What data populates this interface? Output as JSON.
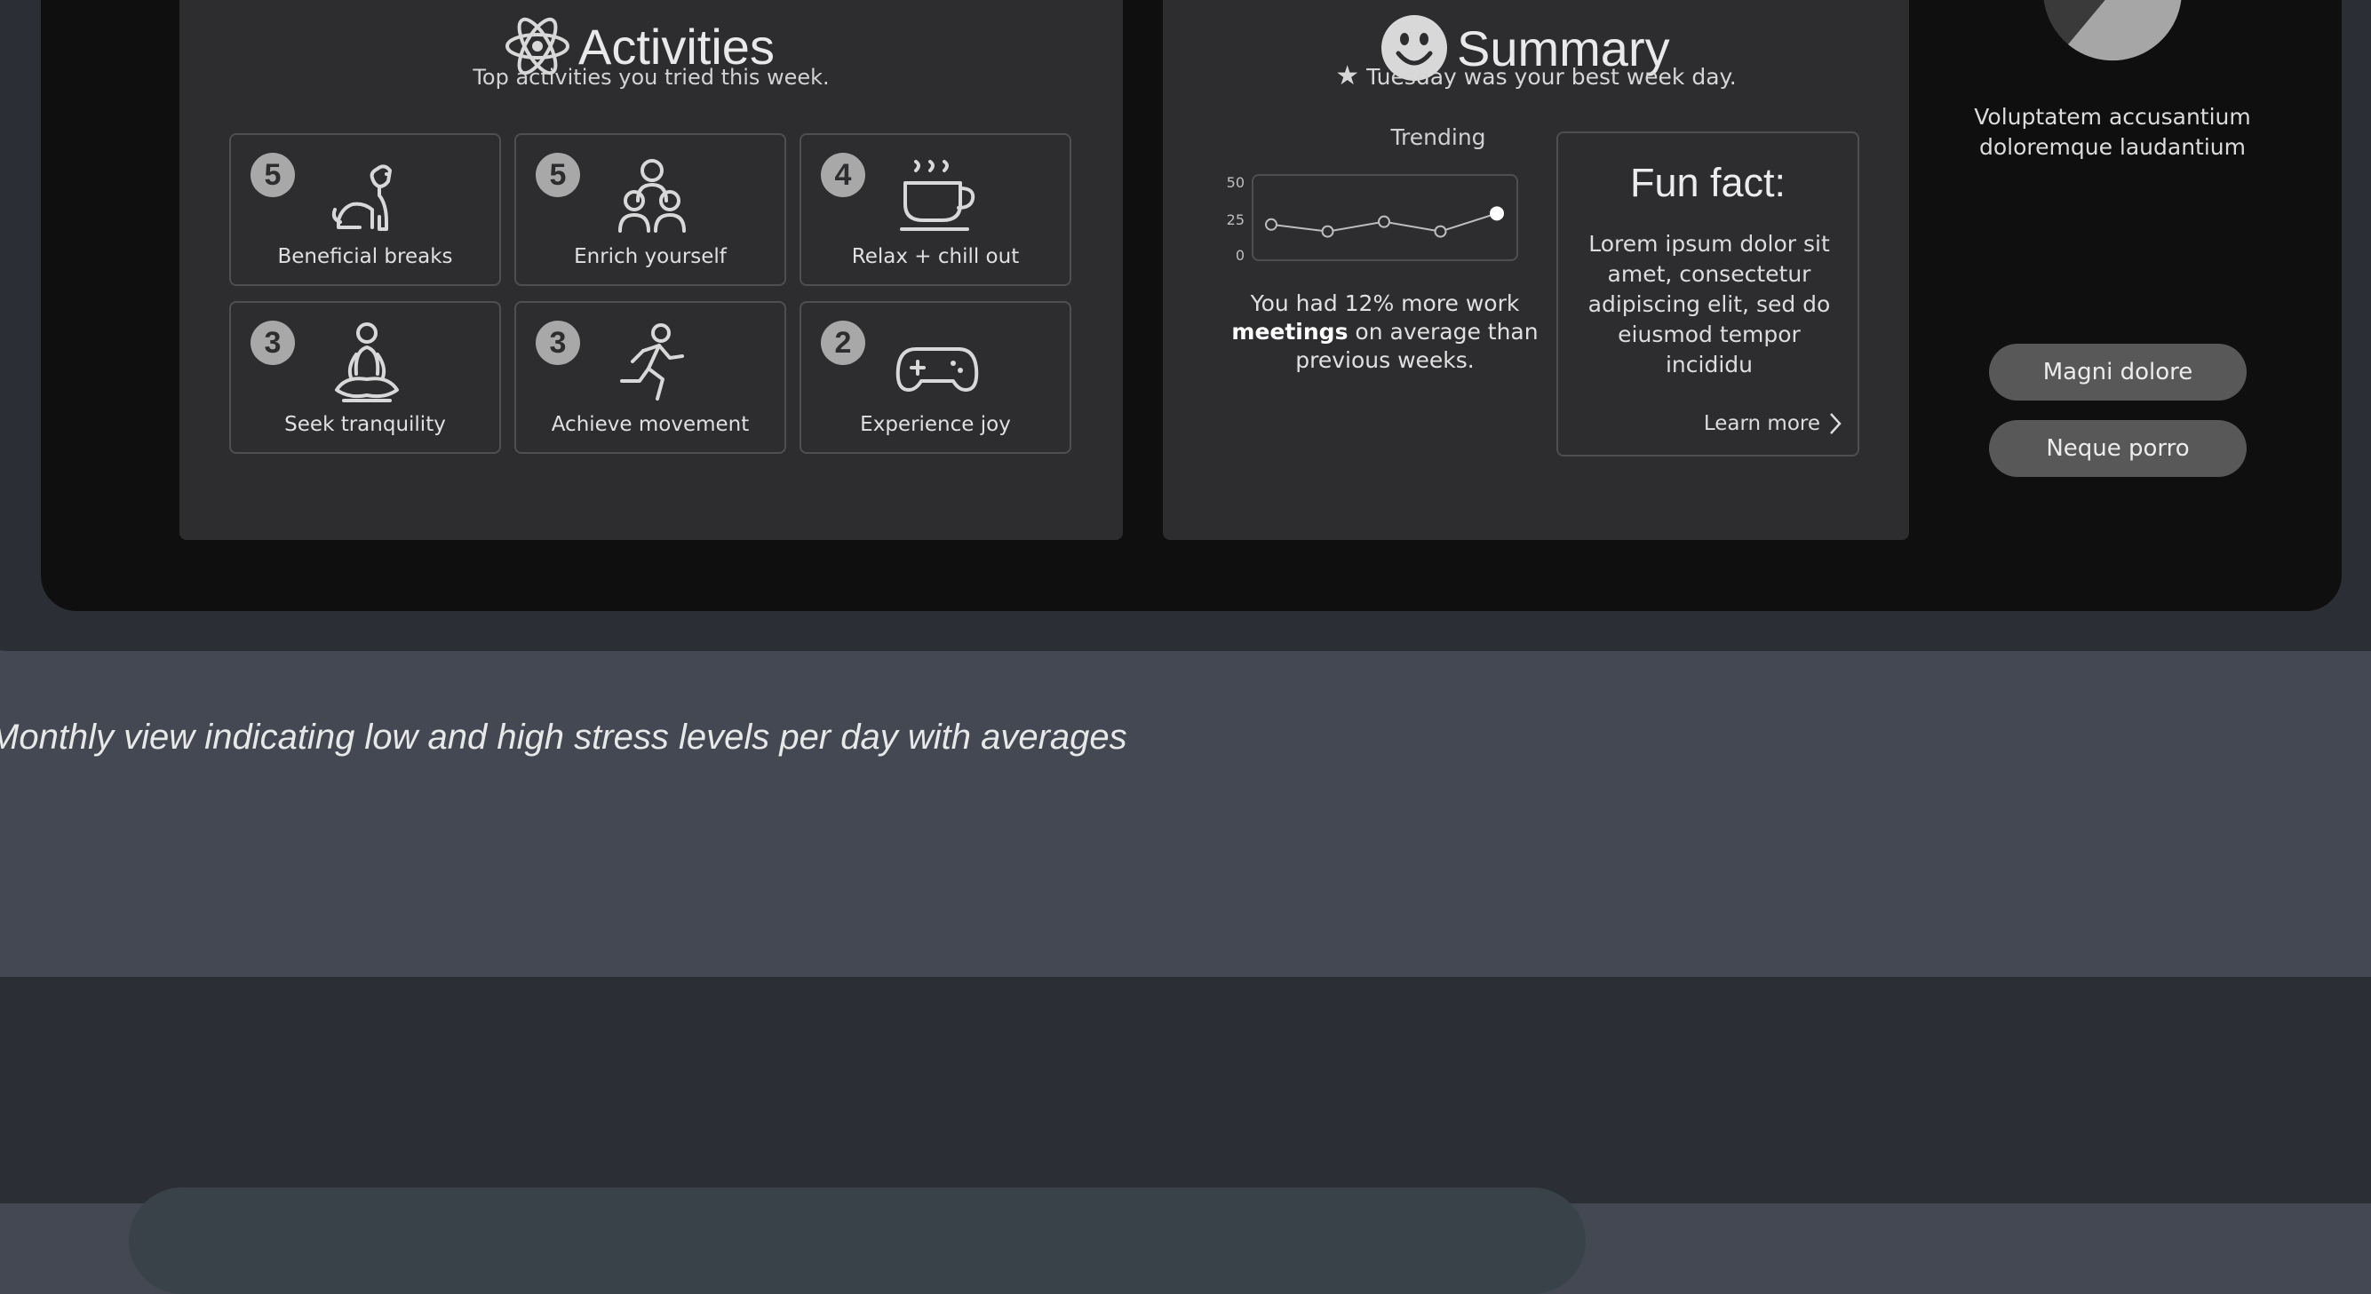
{
  "activities": {
    "title": "Activities",
    "subtitle": "Top activities you tried this week.",
    "items": [
      {
        "count": "5",
        "label": "Beneficial breaks",
        "icon": "dog-icon"
      },
      {
        "count": "5",
        "label": "Enrich yourself",
        "icon": "people-group-icon"
      },
      {
        "count": "4",
        "label": "Relax + chill out",
        "icon": "coffee-cup-icon"
      },
      {
        "count": "3",
        "label": "Seek tranquility",
        "icon": "meditation-icon"
      },
      {
        "count": "3",
        "label": "Achieve movement",
        "icon": "running-icon"
      },
      {
        "count": "2",
        "label": "Experience joy",
        "icon": "gamepad-icon"
      }
    ]
  },
  "summary": {
    "title": "Summary",
    "best_day": "Tuesday was your best week day.",
    "trending_label": "Trending",
    "chart_ticks": [
      "50",
      "25",
      "0"
    ],
    "trend_text_pre": "You had 12% more work",
    "trend_text_bold": "meetings",
    "trend_text_post": "on average than previous weeks.",
    "fun_fact_title": "Fun fact:",
    "fun_fact_text": "Lorem ipsum dolor sit amet, consectetur adipiscing elit, sed do eiusmod tempor incididu",
    "learn_more": "Learn more"
  },
  "chart_data": {
    "type": "line",
    "x": [
      1,
      2,
      3,
      4,
      5
    ],
    "series": [
      {
        "values": [
          20,
          15,
          22,
          15,
          28
        ]
      }
    ],
    "ylim": [
      0,
      50
    ],
    "yticks": [
      "50",
      "25",
      "0"
    ]
  },
  "right_panel": {
    "text": "Voluptatem accusantium doloremque laudantium",
    "button1": "Magni dolore",
    "button2": "Neque porro"
  },
  "caption": "Monthly view indicating low and high stress levels per day with averages",
  "colors": {
    "page_bg": "#434853",
    "screen_bg": "#0f0f10",
    "card_bg": "#2d2d2f",
    "pill_bg": "#585858"
  }
}
